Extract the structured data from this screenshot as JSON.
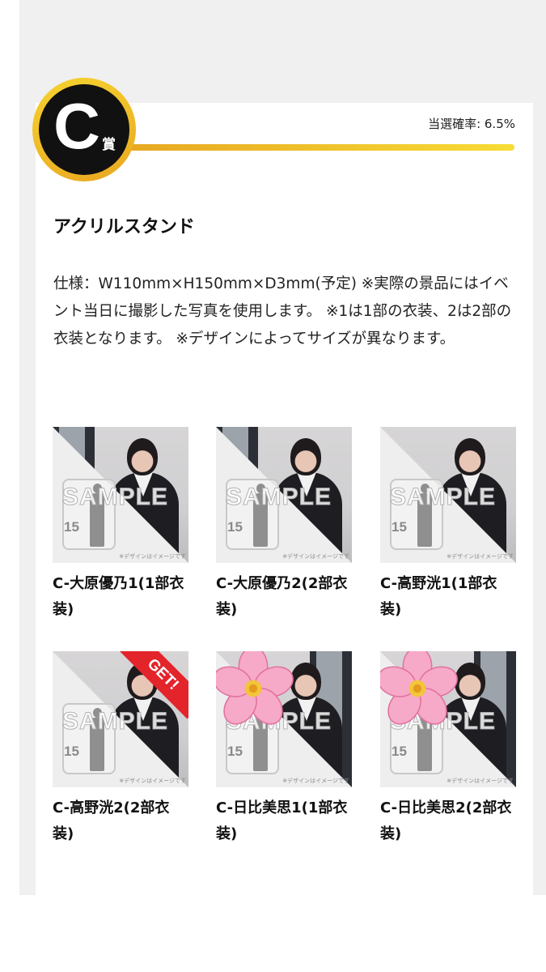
{
  "prize": {
    "grade_letter": "C",
    "grade_suffix": "賞",
    "probability": "当選確率: 6.5%",
    "title": "アクリルスタンド",
    "spec": "仕様：W110mm×H150mm×D3mm(予定) ※実際の景品にはイベント当日に撮影した写真を使用します。 ※1は1部の衣装、2は2部の衣装となります。 ※デザインによってサイズが異なります。"
  },
  "thumbnail_common": {
    "sample_text": "SAMPLE",
    "stand_number": "15",
    "disclaimer": "※デザインはイメージです"
  },
  "items": [
    {
      "name": "C-大原優乃1(1部衣装)",
      "badge": null,
      "hidden": false
    },
    {
      "name": "C-大原優乃2(2部衣装)",
      "badge": null,
      "hidden": false
    },
    {
      "name": "C-高野洸1(1部衣装)",
      "badge": null,
      "hidden": false
    },
    {
      "name": "C-高野洸2(2部衣装)",
      "badge": "GET!",
      "hidden": false
    },
    {
      "name": "C-日比美思1(1部衣装)",
      "badge": null,
      "hidden": true
    },
    {
      "name": "C-日比美思2(2部衣装)",
      "badge": null,
      "hidden": true
    }
  ],
  "colors": {
    "accent_gold": "#f2c72c",
    "get_badge": "#e3242b",
    "blossom": "#f7a9c8"
  }
}
